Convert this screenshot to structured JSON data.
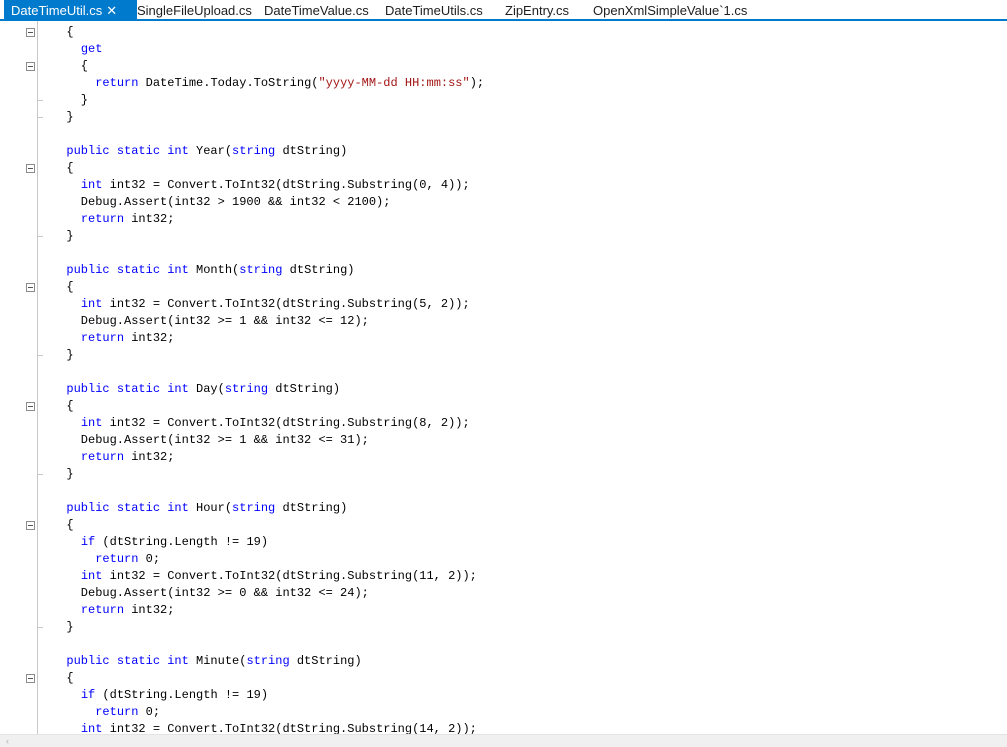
{
  "tabs": [
    {
      "label": "DateTimeUtil.cs",
      "active": true,
      "close_glyph": "✕"
    },
    {
      "label": "SingleFileUpload.cs"
    },
    {
      "label": "DateTimeValue.cs"
    },
    {
      "label": "DateTimeUtils.cs"
    },
    {
      "label": "ZipEntry.cs"
    },
    {
      "label": "OpenXmlSimpleValue`1.cs"
    }
  ],
  "colors": {
    "accent": "#007acc",
    "keyword": "#0000ff",
    "string": "#a31515",
    "text": "#000000"
  },
  "editor": {
    "lines": [
      {
        "fold": true,
        "tokens": [
          [
            "t",
            "  {"
          ]
        ]
      },
      {
        "fold": false,
        "tokens": [
          [
            "t",
            "    "
          ],
          [
            "k",
            "get"
          ]
        ]
      },
      {
        "fold": true,
        "tokens": [
          [
            "t",
            "    {"
          ]
        ]
      },
      {
        "fold": false,
        "tokens": [
          [
            "t",
            "      "
          ],
          [
            "k",
            "return"
          ],
          [
            "t",
            " DateTime.Today.ToString("
          ],
          [
            "s",
            "\"yyyy-MM-dd HH:mm:ss\""
          ],
          [
            "t",
            ");"
          ]
        ]
      },
      {
        "fold": false,
        "end": true,
        "tokens": [
          [
            "t",
            "    }"
          ]
        ]
      },
      {
        "fold": false,
        "end": true,
        "tokens": [
          [
            "t",
            "  }"
          ]
        ]
      },
      {
        "fold": false,
        "tokens": []
      },
      {
        "fold": false,
        "tokens": [
          [
            "t",
            "  "
          ],
          [
            "k",
            "public static int"
          ],
          [
            "t",
            " Year("
          ],
          [
            "k",
            "string"
          ],
          [
            "t",
            " dtString)"
          ]
        ]
      },
      {
        "fold": true,
        "tokens": [
          [
            "t",
            "  {"
          ]
        ]
      },
      {
        "fold": false,
        "tokens": [
          [
            "t",
            "    "
          ],
          [
            "k",
            "int"
          ],
          [
            "t",
            " int32 = Convert.ToInt32(dtString.Substring(0, 4));"
          ]
        ]
      },
      {
        "fold": false,
        "tokens": [
          [
            "t",
            "    Debug.Assert(int32 > 1900 && int32 < 2100);"
          ]
        ]
      },
      {
        "fold": false,
        "tokens": [
          [
            "t",
            "    "
          ],
          [
            "k",
            "return"
          ],
          [
            "t",
            " int32;"
          ]
        ]
      },
      {
        "fold": false,
        "end": true,
        "tokens": [
          [
            "t",
            "  }"
          ]
        ]
      },
      {
        "fold": false,
        "tokens": []
      },
      {
        "fold": false,
        "tokens": [
          [
            "t",
            "  "
          ],
          [
            "k",
            "public static int"
          ],
          [
            "t",
            " Month("
          ],
          [
            "k",
            "string"
          ],
          [
            "t",
            " dtString)"
          ]
        ]
      },
      {
        "fold": true,
        "tokens": [
          [
            "t",
            "  {"
          ]
        ]
      },
      {
        "fold": false,
        "tokens": [
          [
            "t",
            "    "
          ],
          [
            "k",
            "int"
          ],
          [
            "t",
            " int32 = Convert.ToInt32(dtString.Substring(5, 2));"
          ]
        ]
      },
      {
        "fold": false,
        "tokens": [
          [
            "t",
            "    Debug.Assert(int32 >= 1 && int32 <= 12);"
          ]
        ]
      },
      {
        "fold": false,
        "tokens": [
          [
            "t",
            "    "
          ],
          [
            "k",
            "return"
          ],
          [
            "t",
            " int32;"
          ]
        ]
      },
      {
        "fold": false,
        "end": true,
        "tokens": [
          [
            "t",
            "  }"
          ]
        ]
      },
      {
        "fold": false,
        "tokens": []
      },
      {
        "fold": false,
        "tokens": [
          [
            "t",
            "  "
          ],
          [
            "k",
            "public static int"
          ],
          [
            "t",
            " Day("
          ],
          [
            "k",
            "string"
          ],
          [
            "t",
            " dtString)"
          ]
        ]
      },
      {
        "fold": true,
        "tokens": [
          [
            "t",
            "  {"
          ]
        ]
      },
      {
        "fold": false,
        "tokens": [
          [
            "t",
            "    "
          ],
          [
            "k",
            "int"
          ],
          [
            "t",
            " int32 = Convert.ToInt32(dtString.Substring(8, 2));"
          ]
        ]
      },
      {
        "fold": false,
        "tokens": [
          [
            "t",
            "    Debug.Assert(int32 >= 1 && int32 <= 31);"
          ]
        ]
      },
      {
        "fold": false,
        "tokens": [
          [
            "t",
            "    "
          ],
          [
            "k",
            "return"
          ],
          [
            "t",
            " int32;"
          ]
        ]
      },
      {
        "fold": false,
        "end": true,
        "tokens": [
          [
            "t",
            "  }"
          ]
        ]
      },
      {
        "fold": false,
        "tokens": []
      },
      {
        "fold": false,
        "tokens": [
          [
            "t",
            "  "
          ],
          [
            "k",
            "public static int"
          ],
          [
            "t",
            " Hour("
          ],
          [
            "k",
            "string"
          ],
          [
            "t",
            " dtString)"
          ]
        ]
      },
      {
        "fold": true,
        "tokens": [
          [
            "t",
            "  {"
          ]
        ]
      },
      {
        "fold": false,
        "tokens": [
          [
            "t",
            "    "
          ],
          [
            "k",
            "if"
          ],
          [
            "t",
            " (dtString.Length != 19)"
          ]
        ]
      },
      {
        "fold": false,
        "tokens": [
          [
            "t",
            "      "
          ],
          [
            "k",
            "return"
          ],
          [
            "t",
            " 0;"
          ]
        ]
      },
      {
        "fold": false,
        "tokens": [
          [
            "t",
            "    "
          ],
          [
            "k",
            "int"
          ],
          [
            "t",
            " int32 = Convert.ToInt32(dtString.Substring(11, 2));"
          ]
        ]
      },
      {
        "fold": false,
        "tokens": [
          [
            "t",
            "    Debug.Assert(int32 >= 0 && int32 <= 24);"
          ]
        ]
      },
      {
        "fold": false,
        "tokens": [
          [
            "t",
            "    "
          ],
          [
            "k",
            "return"
          ],
          [
            "t",
            " int32;"
          ]
        ]
      },
      {
        "fold": false,
        "end": true,
        "tokens": [
          [
            "t",
            "  }"
          ]
        ]
      },
      {
        "fold": false,
        "tokens": []
      },
      {
        "fold": false,
        "tokens": [
          [
            "t",
            "  "
          ],
          [
            "k",
            "public static int"
          ],
          [
            "t",
            " Minute("
          ],
          [
            "k",
            "string"
          ],
          [
            "t",
            " dtString)"
          ]
        ]
      },
      {
        "fold": true,
        "tokens": [
          [
            "t",
            "  {"
          ]
        ]
      },
      {
        "fold": false,
        "tokens": [
          [
            "t",
            "    "
          ],
          [
            "k",
            "if"
          ],
          [
            "t",
            " (dtString.Length != 19)"
          ]
        ]
      },
      {
        "fold": false,
        "tokens": [
          [
            "t",
            "      "
          ],
          [
            "k",
            "return"
          ],
          [
            "t",
            " 0;"
          ]
        ]
      },
      {
        "fold": false,
        "tokens": [
          [
            "t",
            "    "
          ],
          [
            "k",
            "int"
          ],
          [
            "t",
            " int32 = Convert.ToInt32(dtString.Substring(14, 2));"
          ]
        ]
      }
    ]
  },
  "scrollbar": {
    "left_arrow": "‹"
  }
}
